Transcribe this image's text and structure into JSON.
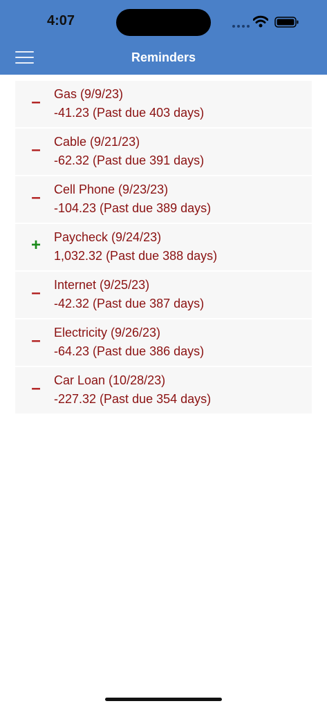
{
  "status_bar": {
    "time": "4:07"
  },
  "nav": {
    "title": "Reminders"
  },
  "colors": {
    "header_bg": "#4a80c8",
    "text_red": "#8b1212",
    "minus_red": "#b01e1e",
    "plus_green": "#1a8a1a",
    "row_bg": "#f7f7f7"
  },
  "reminders": [
    {
      "sign": "minus",
      "title": "Gas (9/9/23)",
      "detail": "-41.23 (Past due 403 days)"
    },
    {
      "sign": "minus",
      "title": "Cable (9/21/23)",
      "detail": "-62.32 (Past due 391 days)"
    },
    {
      "sign": "minus",
      "title": "Cell Phone (9/23/23)",
      "detail": "-104.23 (Past due 389 days)"
    },
    {
      "sign": "plus",
      "title": "Paycheck (9/24/23)",
      "detail": "1,032.32 (Past due 388 days)"
    },
    {
      "sign": "minus",
      "title": "Internet (9/25/23)",
      "detail": "-42.32 (Past due 387 days)"
    },
    {
      "sign": "minus",
      "title": "Electricity (9/26/23)",
      "detail": "-64.23 (Past due 386 days)"
    },
    {
      "sign": "minus",
      "title": "Car Loan (10/28/23)",
      "detail": "-227.32 (Past due 354 days)"
    }
  ]
}
